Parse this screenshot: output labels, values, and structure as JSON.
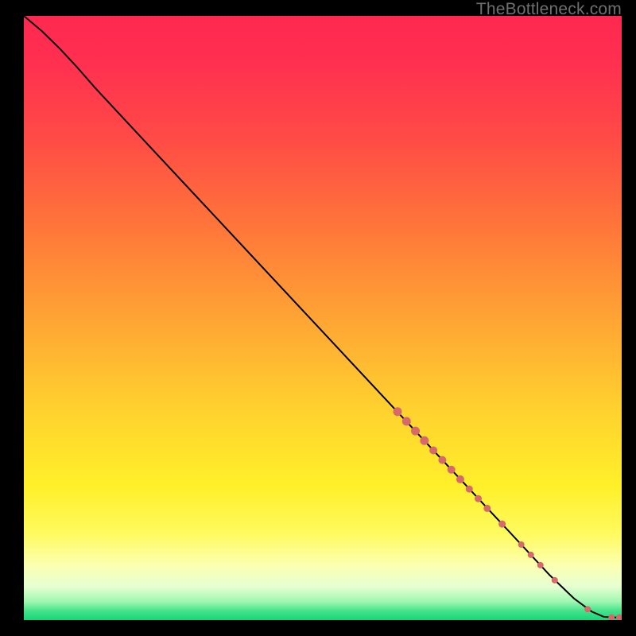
{
  "watermark": "TheBottleneck.com",
  "chart_data": {
    "type": "line",
    "title": "",
    "xlabel": "",
    "ylabel": "",
    "xlim": [
      0,
      100
    ],
    "ylim": [
      0,
      100
    ],
    "grid": false,
    "legend": false,
    "gradient_stops": [
      {
        "offset": 0.0,
        "color": "#ff2850"
      },
      {
        "offset": 0.08,
        "color": "#ff3050"
      },
      {
        "offset": 0.2,
        "color": "#ff4a46"
      },
      {
        "offset": 0.35,
        "color": "#ff763a"
      },
      {
        "offset": 0.5,
        "color": "#ffa434"
      },
      {
        "offset": 0.65,
        "color": "#ffd12e"
      },
      {
        "offset": 0.78,
        "color": "#fff02a"
      },
      {
        "offset": 0.86,
        "color": "#fffb62"
      },
      {
        "offset": 0.91,
        "color": "#fcffb0"
      },
      {
        "offset": 0.945,
        "color": "#e6ffd2"
      },
      {
        "offset": 0.97,
        "color": "#9cf7b0"
      },
      {
        "offset": 0.985,
        "color": "#43e28a"
      },
      {
        "offset": 1.0,
        "color": "#17d679"
      }
    ],
    "series": [
      {
        "name": "curve",
        "type": "line",
        "stroke": "#000000",
        "points": [
          {
            "x": 0.0,
            "y": 100.0
          },
          {
            "x": 3.0,
            "y": 97.5
          },
          {
            "x": 6.0,
            "y": 94.6
          },
          {
            "x": 9.0,
            "y": 91.4
          },
          {
            "x": 12.0,
            "y": 88.0
          },
          {
            "x": 20.0,
            "y": 79.5
          },
          {
            "x": 30.0,
            "y": 68.9
          },
          {
            "x": 40.0,
            "y": 58.3
          },
          {
            "x": 50.0,
            "y": 47.7
          },
          {
            "x": 60.0,
            "y": 37.1
          },
          {
            "x": 70.0,
            "y": 26.5
          },
          {
            "x": 80.0,
            "y": 15.9
          },
          {
            "x": 88.0,
            "y": 7.4
          },
          {
            "x": 92.0,
            "y": 3.6
          },
          {
            "x": 95.0,
            "y": 1.4
          },
          {
            "x": 97.0,
            "y": 0.55
          },
          {
            "x": 98.5,
            "y": 0.45
          },
          {
            "x": 100.0,
            "y": 0.45
          }
        ]
      },
      {
        "name": "markers",
        "type": "scatter",
        "color": "#d66a6a",
        "points": [
          {
            "x": 62.5,
            "y": 34.5,
            "r": 5.5
          },
          {
            "x": 64.0,
            "y": 32.9,
            "r": 5.5
          },
          {
            "x": 65.5,
            "y": 31.3,
            "r": 5.5
          },
          {
            "x": 67.0,
            "y": 29.7,
            "r": 5.5
          },
          {
            "x": 68.5,
            "y": 28.1,
            "r": 5.0
          },
          {
            "x": 70.0,
            "y": 26.5,
            "r": 5.0
          },
          {
            "x": 71.5,
            "y": 24.9,
            "r": 5.0
          },
          {
            "x": 73.0,
            "y": 23.3,
            "r": 5.0
          },
          {
            "x": 74.5,
            "y": 21.7,
            "r": 4.5
          },
          {
            "x": 76.0,
            "y": 20.1,
            "r": 4.5
          },
          {
            "x": 77.5,
            "y": 18.5,
            "r": 4.5
          },
          {
            "x": 80.0,
            "y": 15.9,
            "r": 4.5
          },
          {
            "x": 83.2,
            "y": 12.5,
            "r": 4.0
          },
          {
            "x": 84.8,
            "y": 10.8,
            "r": 4.0
          },
          {
            "x": 86.4,
            "y": 9.1,
            "r": 4.0
          },
          {
            "x": 88.8,
            "y": 6.6,
            "r": 4.0
          },
          {
            "x": 94.3,
            "y": 1.8,
            "r": 4.0
          },
          {
            "x": 98.3,
            "y": 0.45,
            "r": 4.0
          },
          {
            "x": 99.6,
            "y": 0.45,
            "r": 4.0
          }
        ]
      }
    ]
  }
}
